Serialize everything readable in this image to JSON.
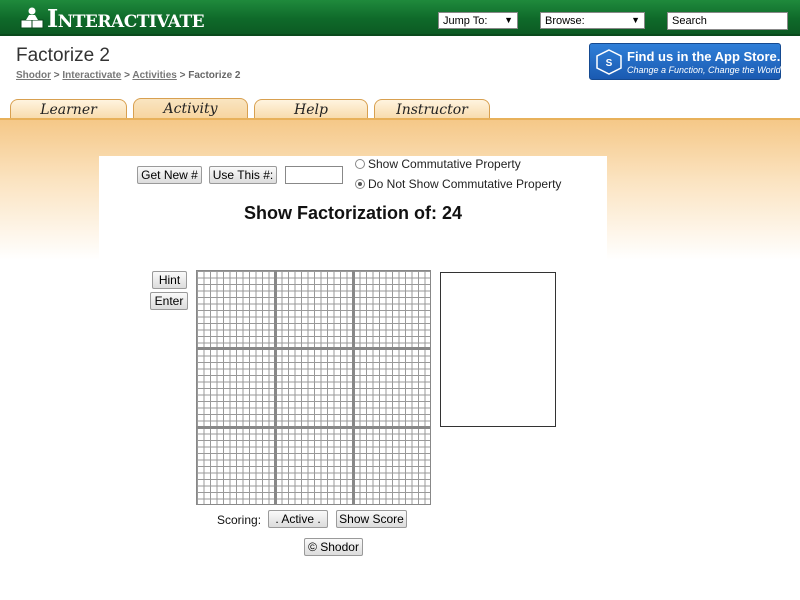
{
  "header": {
    "logo_text": "Interactivate",
    "jump_to": "Jump To:",
    "browse": "Browse:",
    "search": "Search"
  },
  "page": {
    "title": "Factorize 2",
    "breadcrumb": [
      "Shodor",
      "Interactivate",
      "Activities",
      "Factorize 2"
    ]
  },
  "appstore": {
    "line1": "Find us in the App Store.",
    "line2": "Change a Function, Change the World"
  },
  "tabs": [
    {
      "label": "Learner",
      "active": false
    },
    {
      "label": "Activity",
      "active": true
    },
    {
      "label": "Help",
      "active": false
    },
    {
      "label": "Instructor",
      "active": false
    }
  ],
  "controls": {
    "get_new": "Get New #",
    "use_this": "Use This #:",
    "number_input": "",
    "radio_show": "Show Commutative Property",
    "radio_no_show": "Do Not Show Commutative Property",
    "selected_radio": "Do Not Show Commutative Property",
    "hint": "Hint",
    "enter": "Enter",
    "scoring_label": "Scoring:",
    "active": ". Active .",
    "show_score": "Show Score",
    "copyright": "© Shodor"
  },
  "heading": "Show Factorization of: 24",
  "colors": {
    "topbar": "#0f6a2a",
    "tab_gradient": "#f7d8a6",
    "appstore": "#1a5ab1"
  }
}
